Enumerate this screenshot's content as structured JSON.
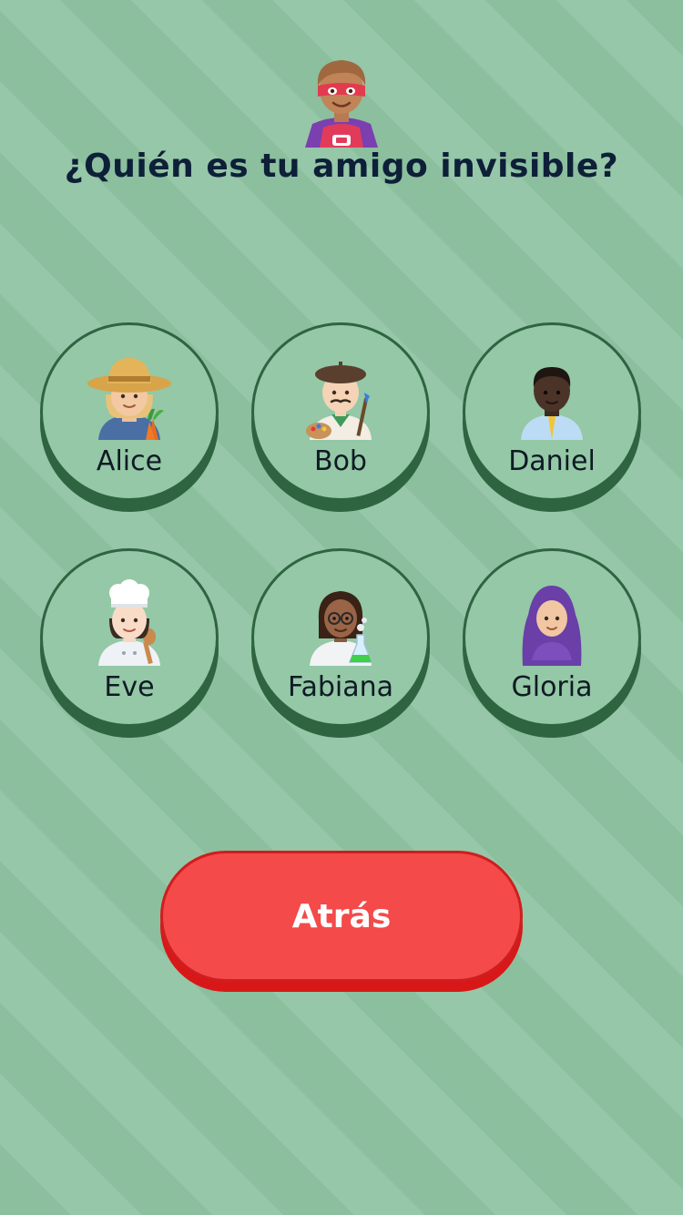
{
  "header": {
    "icon": "superhero-icon",
    "title": "¿Quién es tu amigo invisible?"
  },
  "friends": [
    {
      "name": "Alice",
      "icon": "farmer-woman-icon"
    },
    {
      "name": "Bob",
      "icon": "artist-man-icon"
    },
    {
      "name": "Daniel",
      "icon": "office-worker-man-icon"
    },
    {
      "name": "Eve",
      "icon": "cook-woman-icon"
    },
    {
      "name": "Fabiana",
      "icon": "scientist-woman-icon"
    },
    {
      "name": "Gloria",
      "icon": "headscarf-woman-icon"
    }
  ],
  "back_button": {
    "label": "Atrás"
  },
  "colors": {
    "background": "#8fc3a2",
    "circle_border": "#2f6440",
    "title": "#0e1f38",
    "button": "#f44a4a",
    "button_shadow": "#d81818"
  }
}
